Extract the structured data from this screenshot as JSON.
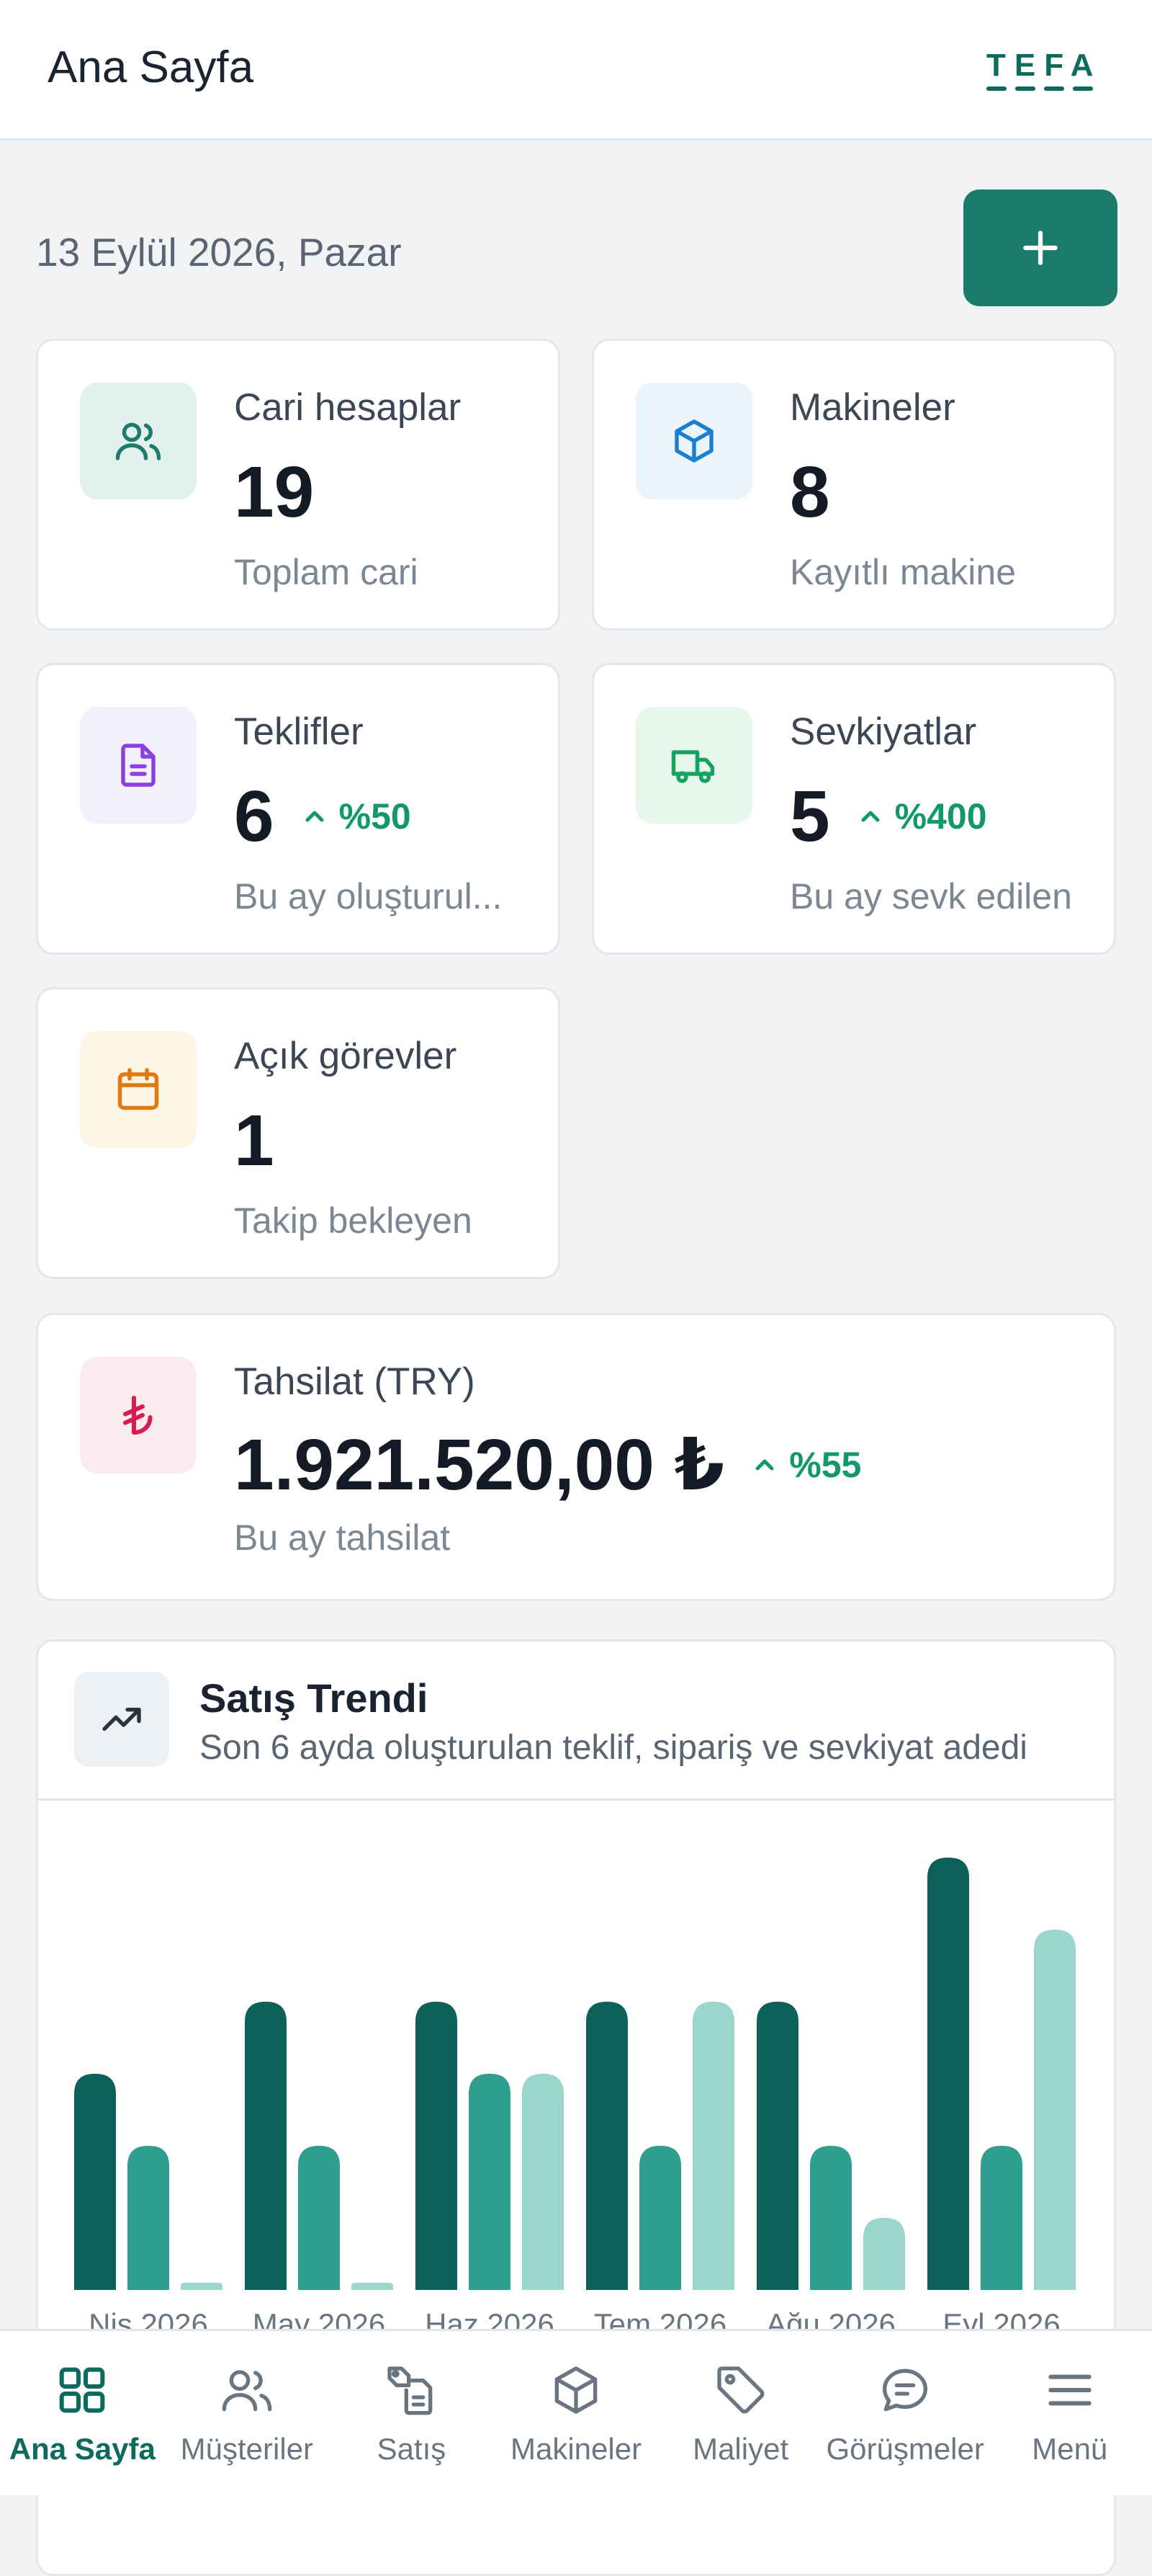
{
  "header": {
    "title": "Ana Sayfa",
    "logo_text": "TEFA"
  },
  "date_text": "13 Eylül 2026, Pazar",
  "stats": {
    "cari": {
      "label": "Cari hesaplar",
      "value": "19",
      "sub": "Toplam cari",
      "icon": "users-icon"
    },
    "makineler": {
      "label": "Makineler",
      "value": "8",
      "sub": "Kayıtlı makine",
      "icon": "box-icon"
    },
    "teklifler": {
      "label": "Teklifler",
      "value": "6",
      "trend": "%50",
      "sub": "Bu ay oluşturul...",
      "icon": "document-icon"
    },
    "sevkiyatlar": {
      "label": "Sevkiyatlar",
      "value": "5",
      "trend": "%400",
      "sub": "Bu ay sevk edilen",
      "icon": "truck-icon"
    },
    "gorevler": {
      "label": "Açık görevler",
      "value": "1",
      "sub": "Takip bekleyen",
      "icon": "calendar-icon"
    },
    "tahsilat": {
      "label": "Tahsilat (TRY)",
      "value": "1.921.520,00 ₺",
      "trend": "%55",
      "sub": "Bu ay tahsilat",
      "icon": "lira-icon"
    }
  },
  "colors": {
    "accent": "#0d6b5e",
    "series_1": "#0d6158",
    "series_2": "#2e9e8e",
    "series_3": "#9ad6cb",
    "trend_up": "#12996a"
  },
  "chart": {
    "title": "Satış Trendi",
    "subtitle": "Son 6 ayda oluşturulan teklif, sipariş ve sevkiyat adedi"
  },
  "chart_data": {
    "type": "bar",
    "categories": [
      "Nis 2026",
      "May 2026",
      "Haz 2026",
      "Tem 2026",
      "Ağu 2026",
      "Eyl 2026"
    ],
    "series": [
      {
        "values": [
          3,
          4,
          4,
          4,
          4,
          6
        ]
      },
      {
        "values": [
          2,
          2,
          3,
          2,
          2,
          2
        ]
      },
      {
        "values": [
          0.1,
          0.1,
          3,
          4,
          1,
          5
        ]
      }
    ],
    "ylim": [
      0,
      6
    ],
    "grid": false,
    "legend": "none"
  },
  "nav": [
    {
      "label": "Ana Sayfa",
      "icon": "grid-icon",
      "active": true
    },
    {
      "label": "Müşteriler",
      "icon": "users-icon"
    },
    {
      "label": "Satış",
      "icon": "sales-tag-document-icon"
    },
    {
      "label": "Makineler",
      "icon": "box-icon"
    },
    {
      "label": "Maliyet",
      "icon": "price-tag-icon"
    },
    {
      "label": "Görüşmeler",
      "icon": "chat-icon"
    },
    {
      "label": "Menü",
      "icon": "hamburger-icon"
    }
  ]
}
